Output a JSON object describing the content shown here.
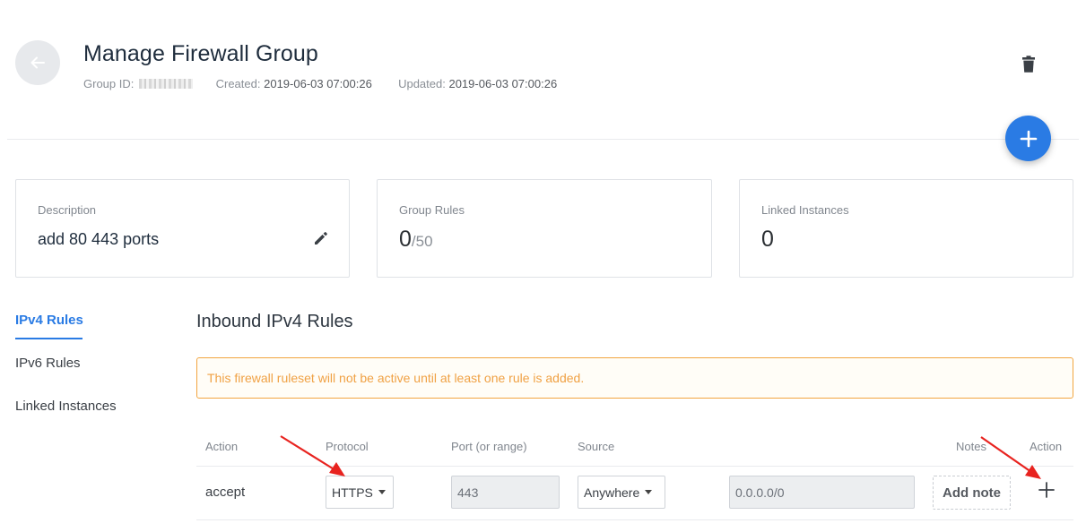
{
  "header": {
    "title": "Manage Firewall Group",
    "group_id_label": "Group ID:",
    "created_label": "Created:",
    "created_value": "2019-06-03 07:00:26",
    "updated_label": "Updated:",
    "updated_value": "2019-06-03 07:00:26"
  },
  "cards": {
    "description": {
      "label": "Description",
      "value": "add 80 443 ports"
    },
    "group_rules": {
      "label": "Group Rules",
      "count": "0",
      "max": "/50"
    },
    "linked_instances": {
      "label": "Linked Instances",
      "count": "0"
    }
  },
  "sidebar": {
    "items": [
      {
        "label": "IPv4 Rules",
        "active": true
      },
      {
        "label": "IPv6 Rules",
        "active": false
      },
      {
        "label": "Linked Instances",
        "active": false
      }
    ]
  },
  "main": {
    "section_title": "Inbound IPv4 Rules",
    "alert": "This firewall ruleset will not be active until at least one rule is added.",
    "columns": {
      "action": "Action",
      "protocol": "Protocol",
      "port": "Port (or range)",
      "source": "Source",
      "notes": "Notes",
      "row_action": "Action"
    },
    "new_rule": {
      "action": "accept",
      "protocol": "HTTPS",
      "port": "443",
      "source": "Anywhere",
      "subnet": "0.0.0.0/0",
      "add_note": "Add note"
    }
  },
  "colors": {
    "accent": "#2a7be4",
    "warning": "#f0a144",
    "annotation_arrow": "#e8231f"
  },
  "icons": [
    "back-arrow-icon",
    "trash-icon",
    "plus-icon",
    "pencil-icon",
    "caret-down-icon",
    "add-rule-plus-icon"
  ]
}
